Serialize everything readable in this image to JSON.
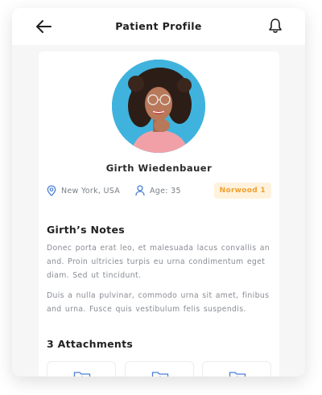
{
  "header": {
    "title": "Patient Profile"
  },
  "patient": {
    "name": "Girth Wiedenbauer",
    "location": "New York, USA",
    "age_label": "Age: 35",
    "badge": "Norwood 1"
  },
  "notes": {
    "title": "Girth’s Notes",
    "paragraph_1": "Donec porta erat leo, et malesuada lacus convallis an and. Proin ultricies turpis eu urna  condimentum  eget diam. Sed ut tincidunt.",
    "paragraph_2": "Duis a nulla pulvinar, commodo urna sit amet, finibus and urna. Fusce quis vestibulum felis suspendis."
  },
  "attachments": {
    "title": "3 Attachments",
    "items": [
      {
        "icon": "folder-download-icon"
      },
      {
        "icon": "folder-download-icon"
      },
      {
        "icon": "folder-download-icon"
      }
    ]
  },
  "colors": {
    "accent_blue": "#4a7fd6",
    "badge_bg": "#fff2dd",
    "badge_text": "#f0a030",
    "avatar_bg": "#3fb3dd"
  }
}
